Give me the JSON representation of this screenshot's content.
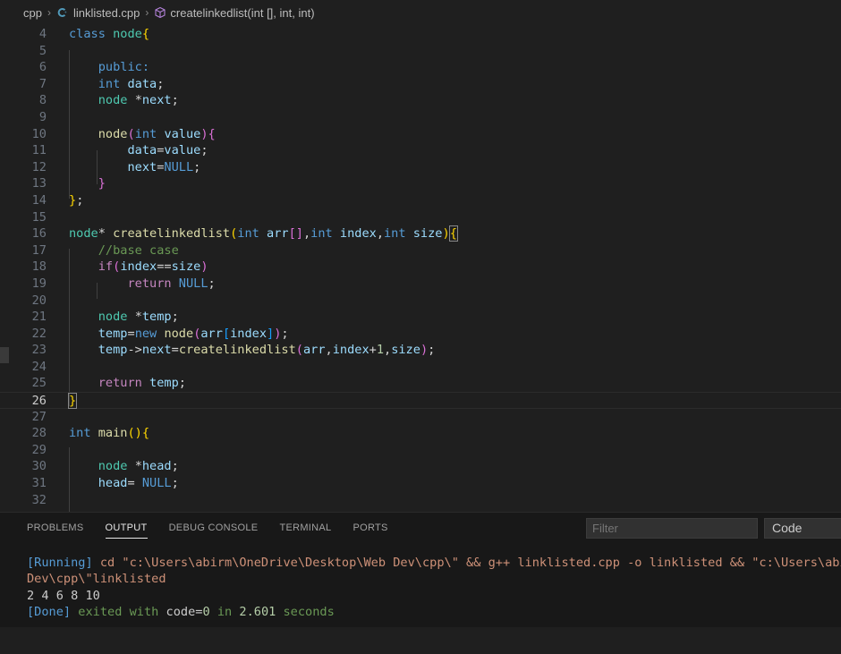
{
  "breadcrumb": {
    "folder": "cpp",
    "file": "linklisted.cpp",
    "symbol": "createlinkedlist(int [], int, int)"
  },
  "editor": {
    "line_numbers": [
      "4",
      "5",
      "6",
      "7",
      "8",
      "9",
      "10",
      "11",
      "12",
      "13",
      "14",
      "15",
      "16",
      "17",
      "18",
      "19",
      "20",
      "21",
      "22",
      "23",
      "24",
      "25",
      "26",
      "27",
      "28",
      "29",
      "30",
      "31",
      "32"
    ],
    "code": {
      "l4": [
        "class",
        "node",
        "{"
      ],
      "l6": "public:",
      "l7": [
        "int",
        "data",
        ";"
      ],
      "l8": [
        "node",
        "*",
        "next",
        ";"
      ],
      "l10": [
        "node",
        "(",
        "int",
        "value",
        ")",
        "{"
      ],
      "l11": [
        "data",
        "=",
        "value",
        ";"
      ],
      "l12": [
        "next",
        "=",
        "NULL",
        ";"
      ],
      "l13": "}",
      "l14": [
        "}",
        ";"
      ],
      "l16": [
        "node",
        "* ",
        "createlinkedlist",
        "(",
        "int",
        "arr",
        "[]",
        ",",
        "int",
        "index",
        ",",
        "int",
        "size",
        ")",
        "{"
      ],
      "l17": "//base case",
      "l18": [
        "if",
        "(",
        "index",
        "==",
        "size",
        ")"
      ],
      "l19": [
        "return",
        "NULL",
        ";"
      ],
      "l21": [
        "node",
        "*",
        "temp",
        ";"
      ],
      "l22": [
        "temp",
        "=",
        "new",
        "node",
        "(",
        "arr",
        "[",
        "index",
        "]",
        ")",
        ";"
      ],
      "l23": [
        "temp",
        "->",
        "next",
        "=",
        "createlinkedlist",
        "(",
        "arr",
        ",",
        "index",
        "+",
        "1",
        ",",
        "size",
        ")",
        ";"
      ],
      "l25": [
        "return",
        "temp",
        ";"
      ],
      "l26": "}",
      "l28": [
        "int",
        "main",
        "()",
        "{"
      ],
      "l30": [
        "node",
        "*",
        "head",
        ";"
      ],
      "l31": [
        "head",
        "=",
        "NULL",
        ";"
      ]
    }
  },
  "panel": {
    "tabs": [
      "PROBLEMS",
      "OUTPUT",
      "DEBUG CONSOLE",
      "TERMINAL",
      "PORTS"
    ],
    "active_tab": "OUTPUT",
    "filter_placeholder": "Filter",
    "select_value": "Code",
    "output": {
      "run_tag": "[Running]",
      "run_cmd": " cd \"c:\\Users\\abirm\\OneDrive\\Desktop\\Web Dev\\cpp\\\" && g++ linklisted.cpp -o linklisted && \"c:\\Users\\abirm\\OneDrive\\Desktop\\Web ",
      "run_cmd_cont": "Dev\\cpp\\\"linklisted",
      "program_output": "2 4 6 8 10",
      "done_tag": "[Done]",
      "done_exited": " exited with ",
      "done_code_label": "code",
      "done_eq": "=",
      "done_code": "0",
      "done_in": " in ",
      "done_secs": "2.601",
      "done_seconds": " seconds"
    }
  },
  "colors": {
    "background": "#1f1f1f",
    "panel_background": "#181818",
    "keyword": "#569cd6",
    "function": "#dcdcaa",
    "variable": "#9cdcfe",
    "comment": "#6a9955",
    "bracket_gold": "#ffd700",
    "bracket_pink": "#da70d6"
  }
}
